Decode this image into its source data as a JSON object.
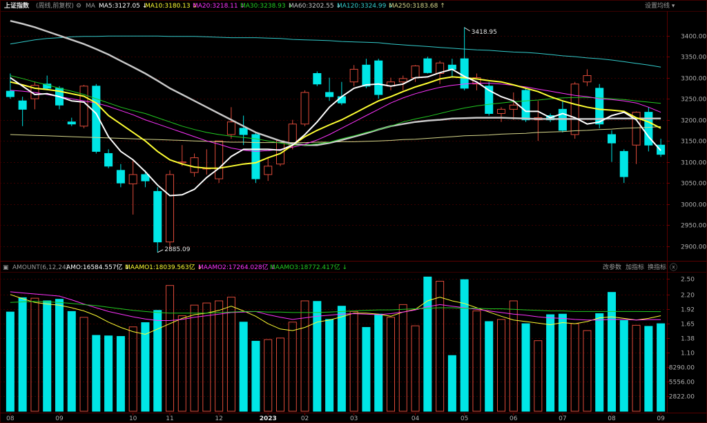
{
  "colors": {
    "background": "#000000",
    "grid": "#3a0000",
    "up": "#e04b3a",
    "down": "#00e6e6",
    "ma5": "#ffffff",
    "ma10": "#ffff33",
    "ma20": "#ff33ff",
    "ma30": "#22cc22",
    "ma60": "#c8c8c8",
    "ma120": "#33cccc",
    "ma250": "#d9d98c",
    "axis_text": "#b0b0b0",
    "label_gray": "#9a9a9a"
  },
  "toolbar": {
    "title": "上证指数",
    "mode": "(周线,前复权)",
    "indicator": "MA",
    "ma_items": [
      {
        "label": "MA5:3127.05",
        "arrow": "↓",
        "color": "#ffffff"
      },
      {
        "label": "MA10:3180.13",
        "arrow": "↓",
        "color": "#ffff33"
      },
      {
        "label": "MA20:3218.11",
        "arrow": "↓",
        "color": "#ff33ff"
      },
      {
        "label": "MA30:3238.93",
        "arrow": "↓",
        "color": "#22cc22"
      },
      {
        "label": "MA60:3202.55",
        "arrow": "↓",
        "color": "#c8c8c8"
      },
      {
        "label": "MA120:3324.99",
        "arrow": "↓",
        "color": "#33cccc"
      },
      {
        "label": "MA250:3183.68",
        "arrow": "↑",
        "color": "#d9d98c"
      }
    ],
    "settings_label": "设置均线"
  },
  "volume_toolbar": {
    "indicator": "AMOUNT(6,12,24)",
    "items": [
      {
        "label": "AMO:16584.557亿",
        "arrow": "↓",
        "color": "#ffffff"
      },
      {
        "label": "MAAMO1:18039.563亿",
        "arrow": "↓",
        "color": "#ffff33"
      },
      {
        "label": "MAAMO2:17264.028亿",
        "arrow": "↓",
        "color": "#ff33ff"
      },
      {
        "label": "MAAMO3:18772.417亿",
        "arrow": "↓",
        "color": "#22cc22"
      }
    ],
    "buttons": [
      "改参数",
      "加指标",
      "换指标"
    ]
  },
  "chart_data": {
    "type": "candlestick",
    "price_axis_ticks": [
      3400,
      3350,
      3300,
      3250,
      3200,
      3150,
      3100,
      3050,
      3000,
      2950,
      2900
    ],
    "price_ylim": [
      2875,
      3455
    ],
    "volume_axis_ticks": [
      "2.50",
      "2.20",
      "1.92",
      "1.65",
      "1.38",
      "1.10",
      "8290.00",
      "5556.00",
      "2822.00"
    ],
    "volume_axis_values": [
      25000,
      22000,
      19200,
      16500,
      13800,
      11000,
      8290,
      5556,
      2822
    ],
    "volume_ylim": [
      0,
      26000
    ],
    "x_labels": [
      {
        "label": "08",
        "index": 0
      },
      {
        "label": "09",
        "index": 4
      },
      {
        "label": "10",
        "index": 10
      },
      {
        "label": "11",
        "index": 13
      },
      {
        "label": "12",
        "index": 17
      },
      {
        "label": "2023",
        "index": 21
      },
      {
        "label": "02",
        "index": 24
      },
      {
        "label": "03",
        "index": 28
      },
      {
        "label": "04",
        "index": 33
      },
      {
        "label": "05",
        "index": 37
      },
      {
        "label": "06",
        "index": 41
      },
      {
        "label": "07",
        "index": 45
      },
      {
        "label": "08",
        "index": 49
      },
      {
        "label": "09",
        "index": 53
      }
    ],
    "annotations": [
      {
        "text": "3418.95",
        "index": 37,
        "value": 3418.95
      },
      {
        "text": "2885.09",
        "index": 12,
        "value": 2885.09
      }
    ],
    "candles": [
      {
        "o": 3268,
        "h": 3310,
        "l": 3250,
        "c": 3255
      },
      {
        "o": 3245,
        "h": 3255,
        "l": 3185,
        "c": 3225
      },
      {
        "o": 3250,
        "h": 3290,
        "l": 3225,
        "c": 3282
      },
      {
        "o": 3285,
        "h": 3305,
        "l": 3270,
        "c": 3275
      },
      {
        "o": 3275,
        "h": 3280,
        "l": 3225,
        "c": 3235
      },
      {
        "o": 3195,
        "h": 3205,
        "l": 3185,
        "c": 3190
      },
      {
        "o": 3185,
        "h": 3283,
        "l": 3180,
        "c": 3280
      },
      {
        "o": 3280,
        "h": 3285,
        "l": 3120,
        "c": 3125
      },
      {
        "o": 3120,
        "h": 3130,
        "l": 3085,
        "c": 3090
      },
      {
        "o": 3080,
        "h": 3095,
        "l": 3040,
        "c": 3050
      },
      {
        "o": 3048,
        "h": 3105,
        "l": 2975,
        "c": 3070
      },
      {
        "o": 3070,
        "h": 3080,
        "l": 3040,
        "c": 3055
      },
      {
        "o": 3030,
        "h": 3040,
        "l": 2885,
        "c": 2910
      },
      {
        "o": 2910,
        "h": 3080,
        "l": 2895,
        "c": 3070
      },
      {
        "o": 3098,
        "h": 3140,
        "l": 3090,
        "c": 3100
      },
      {
        "o": 3075,
        "h": 3120,
        "l": 3065,
        "c": 3110
      },
      {
        "o": 3085,
        "h": 3130,
        "l": 3070,
        "c": 3085
      },
      {
        "o": 3060,
        "h": 3150,
        "l": 3050,
        "c": 3150
      },
      {
        "o": 3165,
        "h": 3230,
        "l": 3155,
        "c": 3195
      },
      {
        "o": 3180,
        "h": 3210,
        "l": 3140,
        "c": 3165
      },
      {
        "o": 3165,
        "h": 3170,
        "l": 3050,
        "c": 3060
      },
      {
        "o": 3070,
        "h": 3110,
        "l": 3055,
        "c": 3090
      },
      {
        "o": 3095,
        "h": 3150,
        "l": 3090,
        "c": 3150
      },
      {
        "o": 3140,
        "h": 3200,
        "l": 3130,
        "c": 3190
      },
      {
        "o": 3190,
        "h": 3270,
        "l": 3185,
        "c": 3265
      },
      {
        "o": 3310,
        "h": 3315,
        "l": 3280,
        "c": 3285
      },
      {
        "o": 3265,
        "h": 3300,
        "l": 3245,
        "c": 3255
      },
      {
        "o": 3255,
        "h": 3290,
        "l": 3235,
        "c": 3240
      },
      {
        "o": 3290,
        "h": 3330,
        "l": 3280,
        "c": 3320
      },
      {
        "o": 3330,
        "h": 3345,
        "l": 3275,
        "c": 3280
      },
      {
        "o": 3340,
        "h": 3345,
        "l": 3250,
        "c": 3260
      },
      {
        "o": 3280,
        "h": 3300,
        "l": 3270,
        "c": 3290
      },
      {
        "o": 3290,
        "h": 3305,
        "l": 3270,
        "c": 3298
      },
      {
        "o": 3300,
        "h": 3330,
        "l": 3290,
        "c": 3328
      },
      {
        "o": 3345,
        "h": 3350,
        "l": 3310,
        "c": 3312
      },
      {
        "o": 3310,
        "h": 3340,
        "l": 3285,
        "c": 3335
      },
      {
        "o": 3330,
        "h": 3345,
        "l": 3300,
        "c": 3320
      },
      {
        "o": 3345,
        "h": 3420,
        "l": 3270,
        "c": 3275
      },
      {
        "o": 3285,
        "h": 3310,
        "l": 3270,
        "c": 3300
      },
      {
        "o": 3280,
        "h": 3290,
        "l": 3210,
        "c": 3215
      },
      {
        "o": 3215,
        "h": 3230,
        "l": 3195,
        "c": 3225
      },
      {
        "o": 3225,
        "h": 3265,
        "l": 3200,
        "c": 3235
      },
      {
        "o": 3270,
        "h": 3275,
        "l": 3195,
        "c": 3200
      },
      {
        "o": 3200,
        "h": 3245,
        "l": 3150,
        "c": 3205
      },
      {
        "o": 3210,
        "h": 3215,
        "l": 3195,
        "c": 3200
      },
      {
        "o": 3225,
        "h": 3245,
        "l": 3170,
        "c": 3175
      },
      {
        "o": 3165,
        "h": 3290,
        "l": 3155,
        "c": 3285
      },
      {
        "o": 3290,
        "h": 3320,
        "l": 3280,
        "c": 3305
      },
      {
        "o": 3275,
        "h": 3285,
        "l": 3180,
        "c": 3190
      },
      {
        "o": 3165,
        "h": 3175,
        "l": 3100,
        "c": 3145
      },
      {
        "o": 3125,
        "h": 3130,
        "l": 3050,
        "c": 3065
      },
      {
        "o": 3140,
        "h": 3220,
        "l": 3095,
        "c": 3218
      },
      {
        "o": 3218,
        "h": 3230,
        "l": 3125,
        "c": 3140
      },
      {
        "o": 3140,
        "h": 3155,
        "l": 3112,
        "c": 3118
      }
    ],
    "amount": [
      18700,
      21400,
      21300,
      20800,
      21100,
      18800,
      17700,
      14300,
      14200,
      14100,
      15900,
      16700,
      19000,
      23700,
      18000,
      20000,
      20400,
      20800,
      21500,
      16800,
      13200,
      13500,
      13800,
      16800,
      20800,
      20700,
      17300,
      19800,
      18800,
      15800,
      18300,
      17700,
      20100,
      16100,
      25300,
      24500,
      10500,
      24800,
      18900,
      16900,
      17300,
      20800,
      16500,
      13300,
      18200,
      18300,
      16500,
      15200,
      18400,
      22400,
      17100,
      16200,
      16000,
      16500
    ],
    "series": [
      {
        "name": "MA5",
        "values": [
          3300,
          3280,
          3260,
          3262,
          3255,
          3245,
          3242,
          3215,
          3160,
          3125,
          3105,
          3077,
          3045,
          3020,
          3022,
          3035,
          3063,
          3085,
          3113,
          3130,
          3130,
          3130,
          3128,
          3140,
          3165,
          3195,
          3230,
          3255,
          3275,
          3283,
          3285,
          3280,
          3285,
          3300,
          3302,
          3312,
          3320,
          3303,
          3290,
          3270,
          3255,
          3245,
          3220,
          3220,
          3205,
          3215,
          3205,
          3190,
          3195,
          3210,
          3218,
          3200,
          3160,
          3127
        ]
      },
      {
        "name": "MA10",
        "values": [
          3290,
          3283,
          3275,
          3272,
          3268,
          3262,
          3256,
          3240,
          3210,
          3190,
          3170,
          3150,
          3125,
          3105,
          3095,
          3088,
          3085,
          3085,
          3090,
          3095,
          3098,
          3110,
          3120,
          3140,
          3160,
          3175,
          3188,
          3200,
          3215,
          3230,
          3245,
          3255,
          3267,
          3278,
          3287,
          3297,
          3302,
          3300,
          3297,
          3293,
          3290,
          3283,
          3275,
          3267,
          3255,
          3245,
          3237,
          3230,
          3225,
          3223,
          3220,
          3205,
          3195,
          3180
        ]
      },
      {
        "name": "MA20",
        "values": [
          3270,
          3268,
          3265,
          3260,
          3255,
          3250,
          3245,
          3240,
          3232,
          3222,
          3212,
          3200,
          3190,
          3180,
          3170,
          3160,
          3150,
          3142,
          3133,
          3128,
          3125,
          3127,
          3130,
          3135,
          3142,
          3152,
          3165,
          3180,
          3195,
          3210,
          3225,
          3240,
          3252,
          3262,
          3270,
          3277,
          3282,
          3285,
          3287,
          3287,
          3285,
          3282,
          3278,
          3273,
          3268,
          3263,
          3258,
          3255,
          3250,
          3248,
          3245,
          3240,
          3230,
          3218
        ]
      },
      {
        "name": "MA30",
        "values": [
          3305,
          3298,
          3290,
          3283,
          3275,
          3268,
          3260,
          3250,
          3240,
          3230,
          3222,
          3215,
          3205,
          3195,
          3185,
          3177,
          3170,
          3165,
          3161,
          3158,
          3155,
          3150,
          3145,
          3140,
          3140,
          3143,
          3147,
          3155,
          3162,
          3170,
          3177,
          3185,
          3195,
          3202,
          3208,
          3215,
          3222,
          3228,
          3233,
          3237,
          3240,
          3243,
          3245,
          3247,
          3250,
          3252,
          3253,
          3253,
          3252,
          3250,
          3248,
          3245,
          3242,
          3239
        ]
      },
      {
        "name": "MA60",
        "values": [
          3435,
          3428,
          3420,
          3410,
          3400,
          3390,
          3380,
          3368,
          3355,
          3340,
          3325,
          3310,
          3293,
          3275,
          3260,
          3245,
          3230,
          3215,
          3200,
          3185,
          3170,
          3160,
          3150,
          3143,
          3140,
          3140,
          3145,
          3152,
          3160,
          3168,
          3177,
          3185,
          3190,
          3195,
          3198,
          3200,
          3203,
          3204,
          3205,
          3205,
          3205,
          3204,
          3203,
          3202,
          3202,
          3202,
          3202,
          3202,
          3202,
          3203,
          3203,
          3203,
          3203,
          3203
        ]
      },
      {
        "name": "MA120",
        "values": [
          3380,
          3385,
          3390,
          3393,
          3395,
          3397,
          3398,
          3398,
          3399,
          3399,
          3399,
          3399,
          3399,
          3398,
          3398,
          3398,
          3397,
          3396,
          3395,
          3395,
          3395,
          3394,
          3393,
          3391,
          3390,
          3389,
          3388,
          3386,
          3385,
          3384,
          3383,
          3380,
          3378,
          3376,
          3374,
          3372,
          3370,
          3368,
          3366,
          3365,
          3363,
          3361,
          3360,
          3358,
          3355,
          3352,
          3350,
          3347,
          3345,
          3342,
          3338,
          3334,
          3330,
          3325
        ]
      },
      {
        "name": "MA250",
        "values": [
          3165,
          3164,
          3163,
          3162,
          3161,
          3160,
          3159,
          3158,
          3157,
          3156,
          3155,
          3154,
          3153,
          3152,
          3151,
          3150,
          3149,
          3148,
          3147,
          3147,
          3146,
          3146,
          3146,
          3146,
          3146,
          3147,
          3147,
          3148,
          3148,
          3149,
          3150,
          3151,
          3153,
          3154,
          3156,
          3158,
          3160,
          3162,
          3163,
          3164,
          3166,
          3167,
          3168,
          3170,
          3171,
          3172,
          3174,
          3175,
          3177,
          3178,
          3180,
          3181,
          3182,
          3184
        ]
      },
      {
        "name": "MAAMO1",
        "values": [
          22000,
          21200,
          20500,
          20200,
          20000,
          19500,
          18900,
          18000,
          16800,
          15800,
          15000,
          14500,
          15500,
          16500,
          17500,
          18200,
          18500,
          19000,
          19800,
          18900,
          17900,
          16500,
          15500,
          15200,
          15800,
          16800,
          17200,
          17800,
          18500,
          18500,
          18300,
          17900,
          18700,
          19200,
          20800,
          21500,
          20800,
          20300,
          19500,
          18700,
          17900,
          17200,
          16900,
          16600,
          16300,
          16700,
          16500,
          16900,
          17600,
          17800,
          17500,
          17200,
          17500,
          18000
        ]
      },
      {
        "name": "MAAMO2",
        "values": [
          22500,
          22300,
          22100,
          21900,
          21700,
          21000,
          20200,
          19500,
          18800,
          18300,
          17800,
          17400,
          17100,
          17100,
          17300,
          17700,
          18000,
          18300,
          18600,
          18700,
          18800,
          18200,
          17700,
          17300,
          17600,
          17900,
          18100,
          18300,
          18400,
          18300,
          18200,
          18400,
          18700,
          19100,
          19700,
          20100,
          19800,
          19500,
          19200,
          18900,
          18600,
          18300,
          18100,
          17800,
          17600,
          17500,
          17300,
          17200,
          17200,
          17300,
          17300,
          17200,
          17250,
          17264
        ]
      },
      {
        "name": "MAAMO3",
        "values": [
          20500,
          20600,
          20700,
          20600,
          20500,
          20300,
          20100,
          19900,
          19600,
          19300,
          19000,
          18800,
          18600,
          18500,
          18500,
          18500,
          18500,
          18600,
          18700,
          18800,
          18800,
          18700,
          18700,
          18600,
          18600,
          18600,
          18700,
          18800,
          18900,
          19000,
          19100,
          19100,
          19200,
          19300,
          19400,
          19500,
          19500,
          19400,
          19400,
          19300,
          19300,
          19200,
          19100,
          19000,
          18900,
          18900,
          18800,
          18800,
          18800,
          18800,
          18800,
          18800,
          18780,
          18772
        ]
      }
    ]
  }
}
